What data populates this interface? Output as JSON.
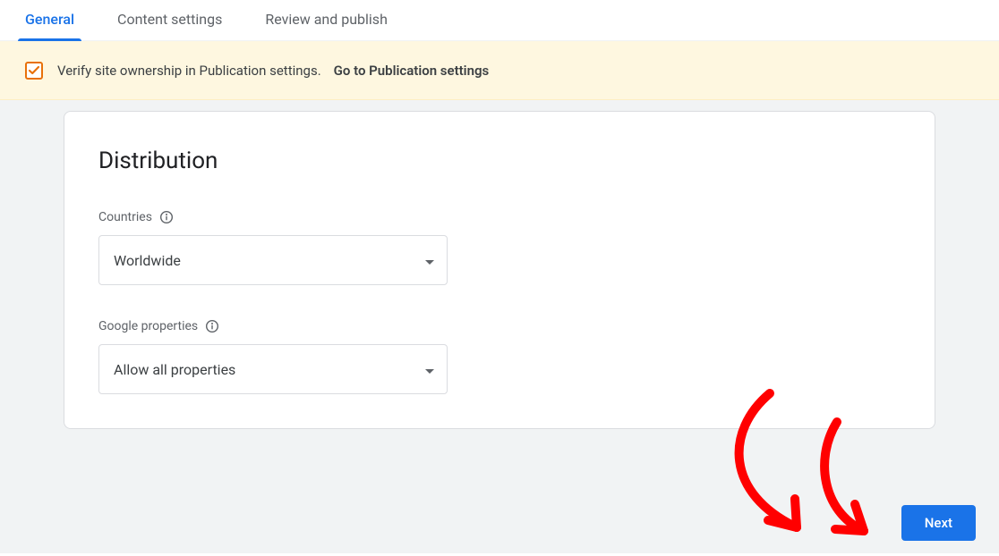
{
  "tabs": {
    "general": "General",
    "content": "Content settings",
    "review": "Review and publish"
  },
  "banner": {
    "message": "Verify site ownership in Publication settings.",
    "link": "Go to Publication settings"
  },
  "card": {
    "heading": "Distribution",
    "countries_label": "Countries",
    "countries_value": "Worldwide",
    "properties_label": "Google properties",
    "properties_value": "Allow all properties"
  },
  "buttons": {
    "next": "Next"
  }
}
